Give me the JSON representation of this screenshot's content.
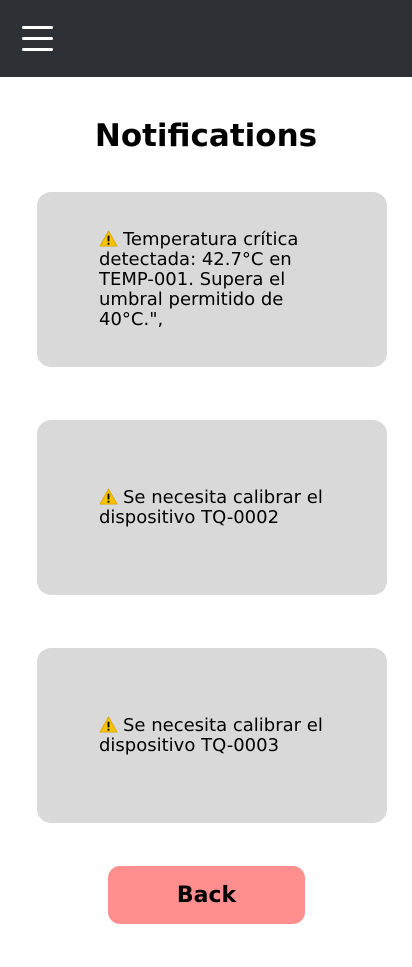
{
  "header": {
    "menu_icon": "hamburger-menu-icon",
    "background_color": "#2d3034"
  },
  "page": {
    "title": "Notifications"
  },
  "notifications": [
    {
      "icon": "warning-icon",
      "text": "Temperatura crítica detectada: 42.7°C en TEMP-001. Supera el umbral permitido de 40°C.\","
    },
    {
      "icon": "warning-icon",
      "text": "Se necesita calibrar el dispositivo TQ-0002"
    },
    {
      "icon": "warning-icon",
      "text": "Se necesita calibrar el dispositivo TQ-0003"
    }
  ],
  "footer": {
    "back_label": "Back",
    "back_color": "#ff8f8f"
  },
  "colors": {
    "card_background": "#d9d9d9",
    "warning": "#f6c300"
  }
}
